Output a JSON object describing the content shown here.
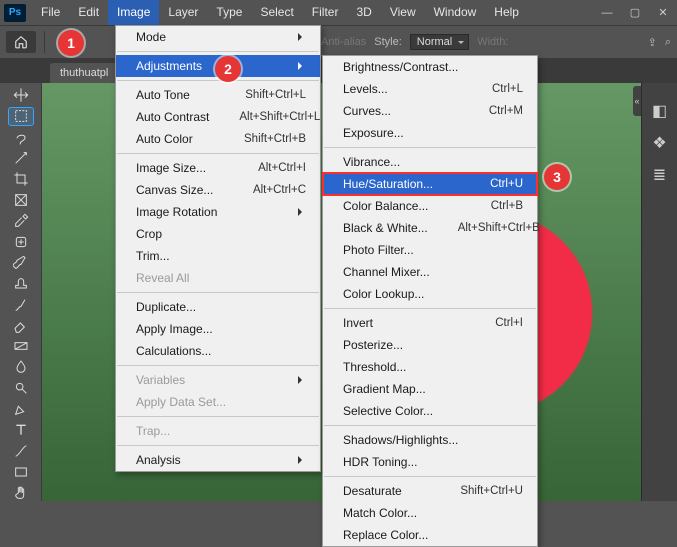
{
  "ps_badge": "Ps",
  "menubar": [
    "File",
    "Edit",
    "Image",
    "Layer",
    "Type",
    "Select",
    "Filter",
    "3D",
    "View",
    "Window",
    "Help"
  ],
  "menubar_active_index": 2,
  "optbar": {
    "antialias": "Anti-alias",
    "style_label": "Style:",
    "style_value": "Normal",
    "width_label": "Width:"
  },
  "tab": {
    "name": "thuthuatpl"
  },
  "callouts": {
    "one": "1",
    "two": "2",
    "three": "3"
  },
  "menu_image": {
    "groups": [
      [
        {
          "l": "Mode",
          "sub": true
        }
      ],
      [
        {
          "l": "Adjustments",
          "sub": true,
          "hl": true
        }
      ],
      [
        {
          "l": "Auto Tone",
          "sc": "Shift+Ctrl+L"
        },
        {
          "l": "Auto Contrast",
          "sc": "Alt+Shift+Ctrl+L"
        },
        {
          "l": "Auto Color",
          "sc": "Shift+Ctrl+B"
        }
      ],
      [
        {
          "l": "Image Size...",
          "sc": "Alt+Ctrl+I"
        },
        {
          "l": "Canvas Size...",
          "sc": "Alt+Ctrl+C"
        },
        {
          "l": "Image Rotation",
          "sub": true
        },
        {
          "l": "Crop"
        },
        {
          "l": "Trim..."
        },
        {
          "l": "Reveal All",
          "disabled": true
        }
      ],
      [
        {
          "l": "Duplicate..."
        },
        {
          "l": "Apply Image..."
        },
        {
          "l": "Calculations..."
        }
      ],
      [
        {
          "l": "Variables",
          "sub": true,
          "disabled": true
        },
        {
          "l": "Apply Data Set...",
          "disabled": true
        }
      ],
      [
        {
          "l": "Trap...",
          "disabled": true
        }
      ],
      [
        {
          "l": "Analysis",
          "sub": true
        }
      ]
    ]
  },
  "menu_adjust": {
    "groups": [
      [
        {
          "l": "Brightness/Contrast..."
        },
        {
          "l": "Levels...",
          "sc": "Ctrl+L"
        },
        {
          "l": "Curves...",
          "sc": "Ctrl+M"
        },
        {
          "l": "Exposure..."
        }
      ],
      [
        {
          "l": "Vibrance..."
        },
        {
          "l": "Hue/Saturation...",
          "sc": "Ctrl+U",
          "hl": true,
          "boxed": true
        },
        {
          "l": "Color Balance...",
          "sc": "Ctrl+B"
        },
        {
          "l": "Black & White...",
          "sc": "Alt+Shift+Ctrl+B"
        },
        {
          "l": "Photo Filter..."
        },
        {
          "l": "Channel Mixer..."
        },
        {
          "l": "Color Lookup..."
        }
      ],
      [
        {
          "l": "Invert",
          "sc": "Ctrl+I"
        },
        {
          "l": "Posterize..."
        },
        {
          "l": "Threshold..."
        },
        {
          "l": "Gradient Map..."
        },
        {
          "l": "Selective Color..."
        }
      ],
      [
        {
          "l": "Shadows/Highlights..."
        },
        {
          "l": "HDR Toning..."
        }
      ],
      [
        {
          "l": "Desaturate",
          "sc": "Shift+Ctrl+U"
        },
        {
          "l": "Match Color..."
        },
        {
          "l": "Replace Color..."
        }
      ]
    ]
  },
  "tool_icons": [
    "move",
    "marquee",
    "lasso",
    "wand",
    "crop",
    "frame",
    "eyedropper",
    "heal",
    "brush",
    "stamp",
    "history",
    "eraser",
    "gradient",
    "blur",
    "dodge",
    "pen",
    "type",
    "path",
    "rect",
    "hand"
  ],
  "panel_icons": [
    "properties",
    "layers",
    "channels"
  ]
}
